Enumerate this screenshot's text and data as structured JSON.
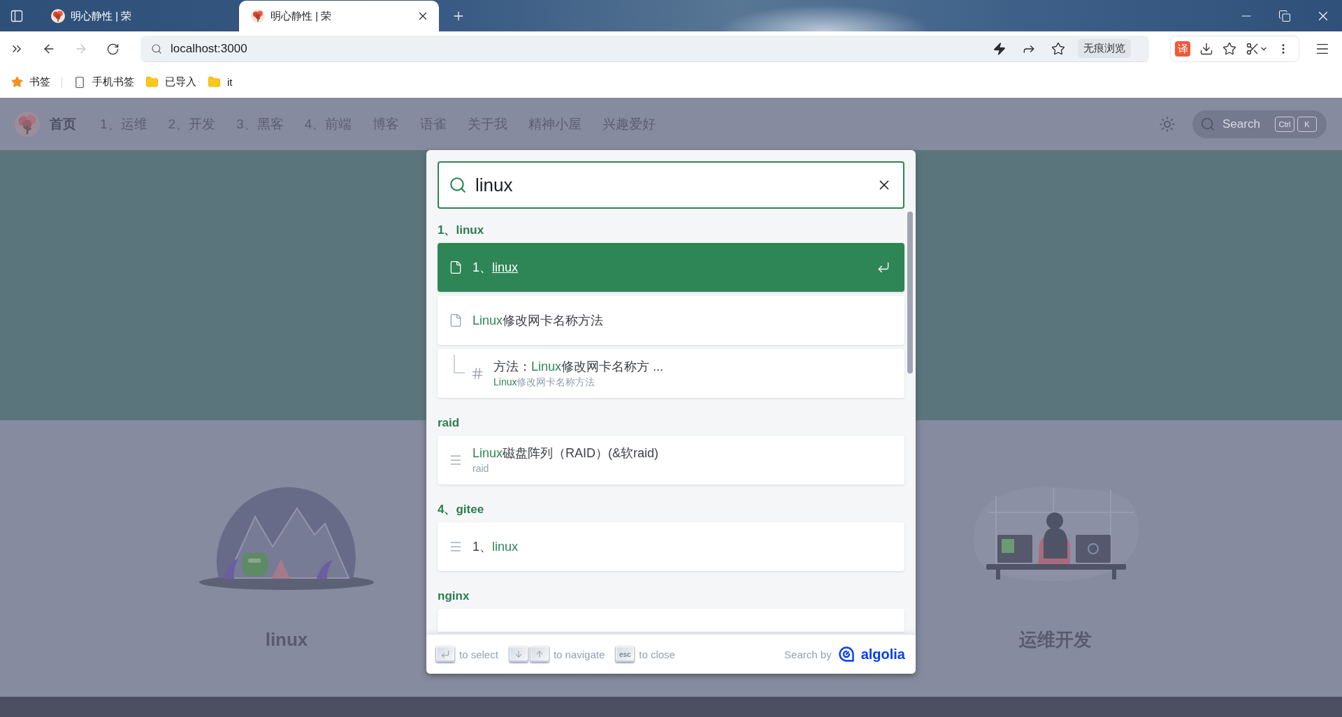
{
  "browser": {
    "tabs": [
      {
        "title": "明心静性 | 荣",
        "selected": false
      },
      {
        "title": "明心静性 | 荣",
        "selected": true
      }
    ],
    "nav_buttons": [
      {
        "kind": "back",
        "disabled": false
      },
      {
        "kind": "forward",
        "disabled": true
      }
    ],
    "address": "localhost:3000",
    "incognito": "无痕浏览",
    "translate": "译",
    "bookmarks": [
      {
        "kind": "star",
        "label": "书签"
      },
      {
        "kind": "phone",
        "label": "手机书签"
      },
      {
        "kind": "folder",
        "label": "已导入"
      },
      {
        "kind": "folder",
        "label": "it"
      }
    ]
  },
  "site": {
    "nav": {
      "home": "首页",
      "items": [
        "1、运维",
        "2、开发",
        "3、黑客",
        "4、前端",
        "博客",
        "语雀",
        "关于我",
        "精神小屋",
        "兴趣爱好"
      ],
      "search": {
        "label": "Search",
        "keys": [
          "Ctrl",
          "K"
        ]
      }
    },
    "features": [
      {
        "kind": "mountains",
        "title": "linux"
      },
      {
        "kind": "desk",
        "title": "运维开发"
      }
    ]
  },
  "search_modal": {
    "query": "linux",
    "sections": [
      {
        "title": "1、linux",
        "hits": [
          {
            "kind": "page",
            "selected": true,
            "title": [
              {
                "text": "1、",
                "match": false
              },
              {
                "text": "linux",
                "match": true
              }
            ]
          },
          {
            "kind": "page",
            "selected": false,
            "title": [
              {
                "text": "Linux",
                "match": true
              },
              {
                "text": "修改网卡名称方法",
                "match": false
              }
            ]
          },
          {
            "kind": "heading",
            "selected": false,
            "title": [
              {
                "text": "方法：",
                "match": false
              },
              {
                "text": "Linux",
                "match": true
              },
              {
                "text": "修改网卡名称方 ...",
                "match": false
              }
            ],
            "path": [
              {
                "text": "Linux",
                "match": true
              },
              {
                "text": "修改网卡名称方法",
                "match": false
              }
            ]
          }
        ]
      },
      {
        "title": "raid",
        "hits": [
          {
            "kind": "text",
            "selected": false,
            "title": [
              {
                "text": "Linux",
                "match": true
              },
              {
                "text": "磁盘阵列（RAID）(&软raid)",
                "match": false
              }
            ],
            "path": [
              {
                "text": "raid",
                "match": false
              }
            ]
          }
        ]
      },
      {
        "title": "4、gitee",
        "hits": [
          {
            "kind": "text",
            "selected": false,
            "title": [
              {
                "text": "1、",
                "match": false
              },
              {
                "text": "linux",
                "match": true
              }
            ]
          }
        ]
      },
      {
        "title": "nginx",
        "hits": [
          {
            "kind": "text",
            "selected": false
          }
        ]
      }
    ],
    "commands": [
      {
        "keys": [
          {
            "kind": "enter"
          }
        ],
        "label": "to select"
      },
      {
        "keys": [
          {
            "kind": "down"
          },
          {
            "kind": "up"
          }
        ],
        "label": "to navigate"
      },
      {
        "keys": [
          {
            "kind": "esc",
            "text": "esc"
          }
        ],
        "label": "to close"
      }
    ],
    "search_by": "Search by",
    "logo_text": "algolia"
  }
}
